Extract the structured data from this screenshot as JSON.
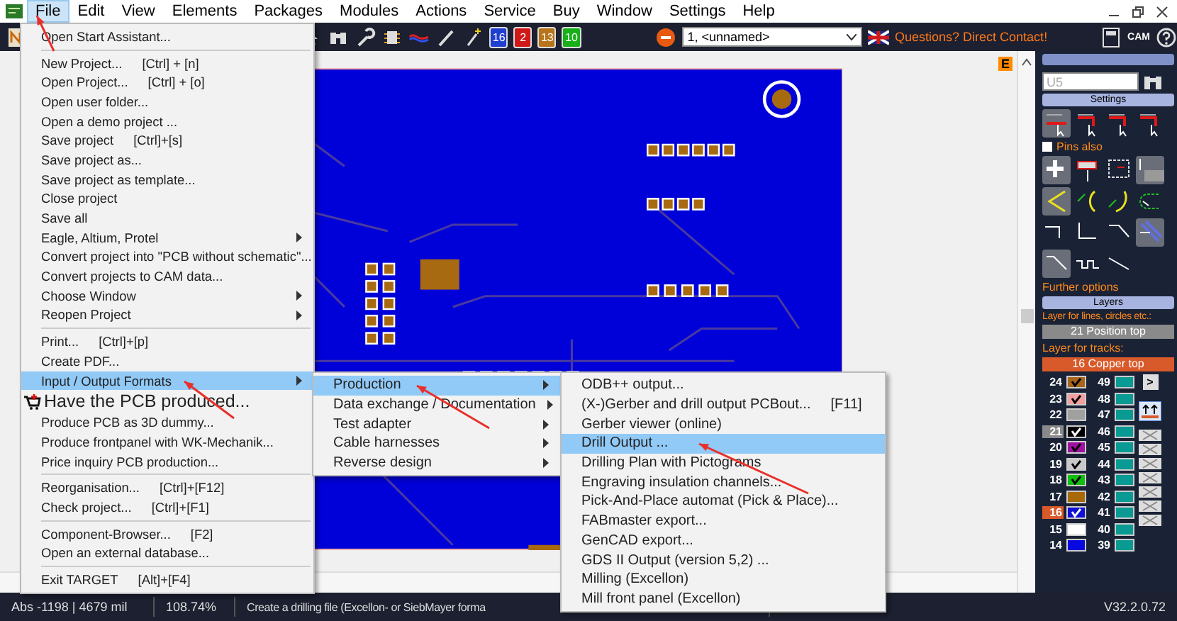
{
  "menubar": [
    {
      "label": "File",
      "selected": true
    },
    {
      "label": "Edit",
      "selected": false
    },
    {
      "label": "View",
      "selected": false
    },
    {
      "label": "Elements",
      "selected": false
    },
    {
      "label": "Packages",
      "selected": false
    },
    {
      "label": "Modules",
      "selected": false
    },
    {
      "label": "Actions",
      "selected": false
    },
    {
      "label": "Service",
      "selected": false
    },
    {
      "label": "Buy",
      "selected": false
    },
    {
      "label": "Window",
      "selected": false
    },
    {
      "label": "Settings",
      "selected": false
    },
    {
      "label": "Help",
      "selected": false
    }
  ],
  "toolbar": {
    "layer_badges": [
      {
        "label": "16",
        "color": "#1f3fd0"
      },
      {
        "label": "2",
        "color": "#d01818"
      },
      {
        "label": "13",
        "color": "#b8741a"
      },
      {
        "label": "10",
        "color": "#18b018"
      }
    ],
    "layer_select": "1, <unnamed>",
    "contact_link": "Questions? Direct Contact!",
    "cam_label": "CAM"
  },
  "canvas": {
    "corner_marker": "E"
  },
  "file_menu": [
    {
      "kind": "item",
      "label": "Open Start Assistant...",
      "selected": false
    },
    {
      "kind": "separator"
    },
    {
      "kind": "item",
      "label": "New Project...",
      "shortcut": "[Ctrl] + [n]",
      "selected": false
    },
    {
      "kind": "item",
      "label": "Open Project...",
      "shortcut": "[Ctrl] + [o]",
      "selected": false
    },
    {
      "kind": "item",
      "label": "Open user folder...",
      "selected": false
    },
    {
      "kind": "item",
      "label": "Open a demo project ...",
      "selected": false
    },
    {
      "kind": "item",
      "label": "Save project",
      "shortcut": "[Ctrl]+[s]",
      "selected": false
    },
    {
      "kind": "item",
      "label": "Save project as...",
      "selected": false
    },
    {
      "kind": "item",
      "label": "Save project as template...",
      "selected": false
    },
    {
      "kind": "item",
      "label": "Close project",
      "selected": false
    },
    {
      "kind": "item",
      "label": "Save all",
      "selected": false
    },
    {
      "kind": "submenu",
      "label": "Eagle, Altium, Protel",
      "selected": false
    },
    {
      "kind": "item",
      "label": "Convert project into \"PCB without schematic\"...",
      "selected": false
    },
    {
      "kind": "item",
      "label": "Convert projects to CAM data...",
      "selected": false
    },
    {
      "kind": "submenu",
      "label": "Choose Window",
      "selected": false
    },
    {
      "kind": "submenu",
      "label": "Reopen Project",
      "selected": false
    },
    {
      "kind": "separator"
    },
    {
      "kind": "item",
      "label": "Print...",
      "shortcut": "[Ctrl]+[p]",
      "selected": false
    },
    {
      "kind": "item",
      "label": "Create PDF...",
      "selected": false
    },
    {
      "kind": "submenu",
      "label": "Input / Output Formats",
      "selected": true
    },
    {
      "kind": "promo",
      "label": "Have the PCB produced...",
      "selected": false
    },
    {
      "kind": "item",
      "label": "Produce PCB as 3D dummy...",
      "selected": false
    },
    {
      "kind": "item",
      "label": "Produce frontpanel with WK-Mechanik...",
      "selected": false
    },
    {
      "kind": "item",
      "label": "Price inquiry PCB production...",
      "selected": false
    },
    {
      "kind": "separator"
    },
    {
      "kind": "item",
      "label": "Reorganisation...",
      "shortcut": "[Ctrl]+[F12]",
      "selected": false
    },
    {
      "kind": "item",
      "label": "Check project...",
      "shortcut": "[Ctrl]+[F1]",
      "selected": false
    },
    {
      "kind": "separator"
    },
    {
      "kind": "item",
      "label": "Component-Browser...",
      "shortcut": "[F2]",
      "selected": false
    },
    {
      "kind": "item",
      "label": "Open an external database...",
      "selected": false
    },
    {
      "kind": "separator"
    },
    {
      "kind": "item",
      "label": "Exit TARGET",
      "shortcut": "[Alt]+[F4]",
      "selected": false
    }
  ],
  "io_submenu": [
    {
      "kind": "submenu",
      "label": "Production",
      "selected": true
    },
    {
      "kind": "submenu",
      "label": "Data exchange / Documentation",
      "selected": false
    },
    {
      "kind": "submenu",
      "label": "Test adapter",
      "selected": false
    },
    {
      "kind": "submenu",
      "label": "Cable harnesses",
      "selected": false
    },
    {
      "kind": "submenu",
      "label": "Reverse design",
      "selected": false
    }
  ],
  "production_submenu": [
    {
      "kind": "item",
      "label": "ODB++ output...",
      "selected": false
    },
    {
      "kind": "item",
      "label": "(X-)Gerber and drill output PCBout...",
      "shortcut": "[F11]",
      "selected": false
    },
    {
      "kind": "item",
      "label": "Gerber viewer (online)",
      "selected": false
    },
    {
      "kind": "item",
      "label": "Drill Output ...",
      "selected": true
    },
    {
      "kind": "item",
      "label": "Drilling Plan with Pictograms",
      "selected": false
    },
    {
      "kind": "item",
      "label": "Engraving insulation channels...",
      "selected": false
    },
    {
      "kind": "item",
      "label": "Pick-And-Place automat (Pick & Place)...",
      "selected": false
    },
    {
      "kind": "item",
      "label": "FABmaster export...",
      "selected": false
    },
    {
      "kind": "item",
      "label": "GenCAD export...",
      "selected": false
    },
    {
      "kind": "item",
      "label": "GDS II Output (version 5,2) ...",
      "selected": false
    },
    {
      "kind": "item",
      "label": "Milling (Excellon)",
      "selected": false
    },
    {
      "kind": "item",
      "label": "Mill front panel (Excellon)",
      "selected": false
    }
  ],
  "right_panel": {
    "search": {
      "value": "U5"
    },
    "settings_title": "Settings",
    "pins_also": {
      "label": "Pins also",
      "checked": false
    },
    "further_options": "Further options",
    "layers_title": "Layers",
    "line_layer_label": "Layer for lines, circles etc.:",
    "line_layer": "21 Position top",
    "track_layer_label": "Layer for tracks:",
    "track_layer": "16 Copper top",
    "more_button": ">",
    "layers": [
      {
        "number": "24",
        "color": "#a8661c",
        "checked": true,
        "selected": false,
        "line_layer": false
      },
      {
        "number": "23",
        "color": "#f4a0a0",
        "checked": true,
        "selected": false,
        "line_layer": false
      },
      {
        "number": "22",
        "color": "#a0a0a0",
        "checked": false,
        "selected": false,
        "line_layer": false
      },
      {
        "number": "21",
        "color": "#000000",
        "checked": true,
        "selected": false,
        "line_layer": true
      },
      {
        "number": "20",
        "color": "#a010a0",
        "checked": true,
        "selected": false,
        "line_layer": false
      },
      {
        "number": "19",
        "color": "#c8c8c8",
        "checked": true,
        "selected": false,
        "line_layer": false
      },
      {
        "number": "18",
        "color": "#10c010",
        "checked": true,
        "selected": false,
        "line_layer": false
      },
      {
        "number": "17",
        "color": "#a86a08",
        "checked": false,
        "selected": false,
        "line_layer": false
      },
      {
        "number": "16",
        "color": "#1010d8",
        "checked": true,
        "selected": true,
        "line_layer": false
      },
      {
        "number": "15",
        "color": "#ffffff",
        "checked": false,
        "selected": false,
        "line_layer": false
      },
      {
        "number": "14",
        "color": "#0808e0",
        "checked": false,
        "selected": false,
        "line_layer": false
      }
    ],
    "inner_layers": [
      {
        "number": "49",
        "color": "#0a9a94"
      },
      {
        "number": "48",
        "color": "#0a9a94"
      },
      {
        "number": "47",
        "color": "#0a9a94"
      },
      {
        "number": "46",
        "color": "#0a9a94"
      },
      {
        "number": "45",
        "color": "#0a9a94"
      },
      {
        "number": "44",
        "color": "#0a9a94"
      },
      {
        "number": "43",
        "color": "#0a9a94"
      },
      {
        "number": "42",
        "color": "#0a9a94"
      },
      {
        "number": "41",
        "color": "#0a9a94"
      },
      {
        "number": "40",
        "color": "#0a9a94"
      },
      {
        "number": "39",
        "color": "#0a9a94"
      }
    ]
  },
  "status_bar": {
    "coordinates": "Abs -1198 | 4679 mil",
    "zoom": "108.74%",
    "hint": "Create a drilling file (Excellon- or SiebMayer forma",
    "version": "V32.2.0.72"
  }
}
